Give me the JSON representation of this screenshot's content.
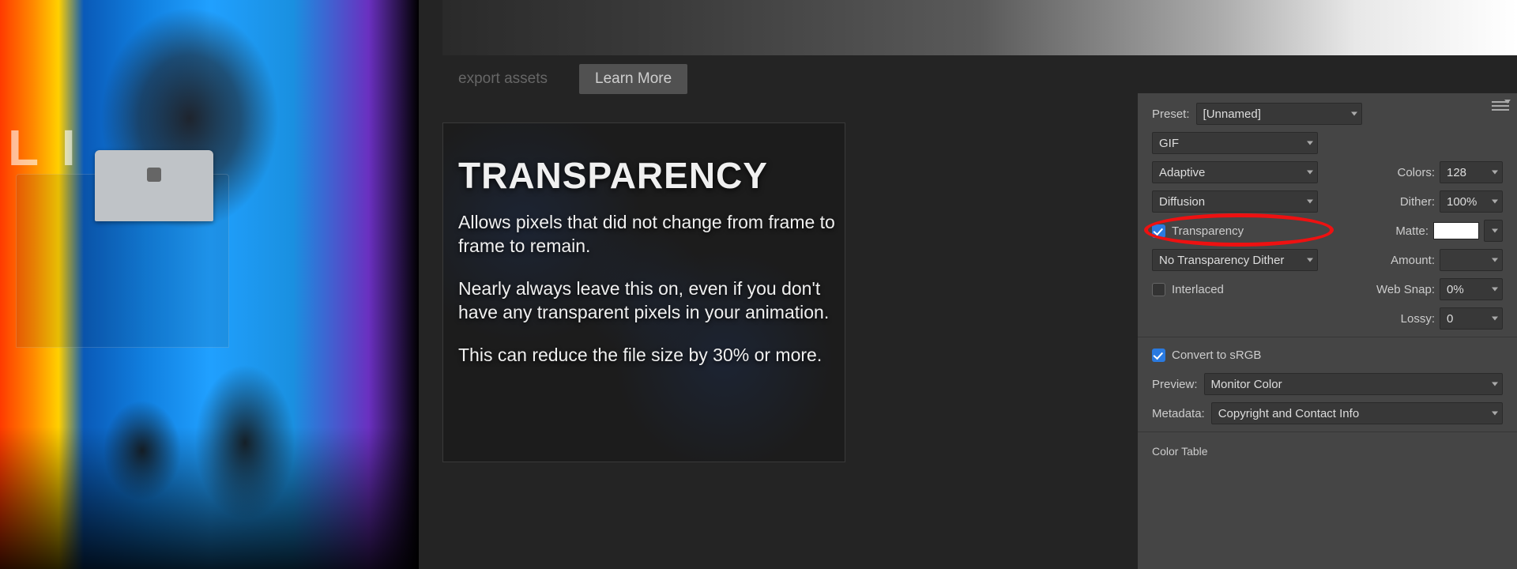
{
  "photo": {
    "background_text": "L I"
  },
  "slide": {
    "tabs": {
      "export": "export assets",
      "learn": "Learn More"
    },
    "title": "TRANSPARENCY",
    "p1": "Allows pixels that did not change from frame to frame to remain.",
    "p2": "Nearly always leave this on, even if you don't have any transparent pixels in your animation.",
    "p3": "This can reduce the file size by 30% or more."
  },
  "panel": {
    "preset_label": "Preset:",
    "preset_value": "[Unnamed]",
    "format": "GIF",
    "palette": "Adaptive",
    "colors_label": "Colors:",
    "colors_value": "128",
    "dither_algo": "Diffusion",
    "dither_label": "Dither:",
    "dither_value": "100%",
    "transparency_label": "Transparency",
    "matte_label": "Matte:",
    "trans_dither": "No Transparency Dither",
    "amount_label": "Amount:",
    "interlaced_label": "Interlaced",
    "websnap_label": "Web Snap:",
    "websnap_value": "0%",
    "lossy_label": "Lossy:",
    "lossy_value": "0",
    "convert_srgb": "Convert to sRGB",
    "preview_label": "Preview:",
    "preview_value": "Monitor Color",
    "metadata_label": "Metadata:",
    "metadata_value": "Copyright and Contact Info",
    "color_table": "Color Table"
  }
}
